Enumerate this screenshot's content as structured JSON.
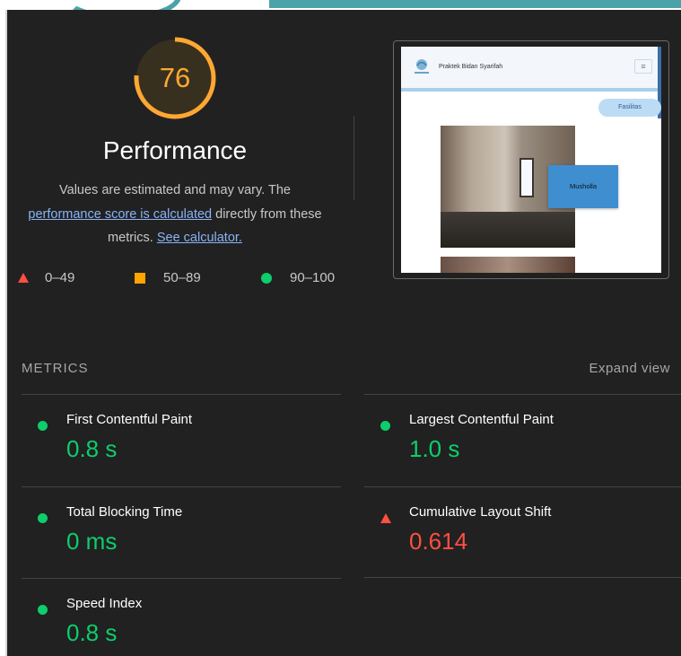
{
  "gauge": {
    "score": "76",
    "fraction": 0.76,
    "color": "#ffa733"
  },
  "performance": {
    "title": "Performance",
    "desc_line1": "Values are estimated and may vary. The",
    "link_score": "performance score is calculated",
    "desc_line2_rest": " directly from these",
    "desc_line3": "metrics. ",
    "link_calculator": "See calculator."
  },
  "legend": [
    {
      "label": "0–49",
      "shape": "triangle",
      "color": "#ff4e42"
    },
    {
      "label": "50–89",
      "shape": "square",
      "color": "#ffa400"
    },
    {
      "label": "90–100",
      "shape": "circle",
      "color": "#0cce6b"
    }
  ],
  "thumbnail": {
    "brand": "Praktek Bidan Syarifah",
    "menu_icon": "hamburger-icon",
    "pill": "Fasilitas",
    "caption": "Musholla"
  },
  "metrics": {
    "title": "METRICS",
    "expand_label": "Expand view",
    "items": [
      {
        "label": "First Contentful Paint",
        "value": "0.8 s",
        "status": "pass"
      },
      {
        "label": "Largest Contentful Paint",
        "value": "1.0 s",
        "status": "pass"
      },
      {
        "label": "Total Blocking Time",
        "value": "0 ms",
        "status": "pass"
      },
      {
        "label": "Cumulative Layout Shift",
        "value": "0.614",
        "status": "fail"
      },
      {
        "label": "Speed Index",
        "value": "0.8 s",
        "status": "pass"
      }
    ]
  }
}
